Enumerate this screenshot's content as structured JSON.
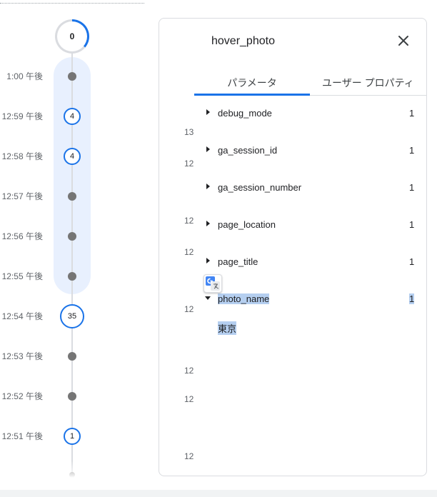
{
  "timeline": {
    "top_counter": "0",
    "rows": [
      {
        "time": "1:00 午後",
        "badge": ""
      },
      {
        "time": "12:59 午後",
        "badge": "4"
      },
      {
        "time": "12:58 午後",
        "badge": "4"
      },
      {
        "time": "12:57 午後",
        "badge": ""
      },
      {
        "time": "12:56 午後",
        "badge": ""
      },
      {
        "time": "12:55 午後",
        "badge": ""
      },
      {
        "time": "12:54 午後",
        "badge": "35"
      },
      {
        "time": "12:53 午後",
        "badge": ""
      },
      {
        "time": "12:52 午後",
        "badge": ""
      },
      {
        "time": "12:51 午後",
        "badge": "1"
      }
    ]
  },
  "panel": {
    "title": "hover_photo",
    "tabs": [
      {
        "label": "パラメータ",
        "active": true
      },
      {
        "label": "ユーザー プロパティ",
        "active": false
      }
    ],
    "side_numbers": [
      "13",
      "12",
      "12",
      "12",
      "12",
      "12",
      "12",
      "12"
    ],
    "params": [
      {
        "name": "debug_mode",
        "count": "1"
      },
      {
        "name": "ga_session_id",
        "count": "1"
      },
      {
        "name": "ga_session_number",
        "count": "1"
      },
      {
        "name": "page_location",
        "count": "1"
      },
      {
        "name": "page_title",
        "count": "1"
      },
      {
        "name": "photo_name",
        "count": "1",
        "expanded": true,
        "value": "東京"
      }
    ]
  },
  "colors": {
    "accent": "#1a73e8",
    "highlight": "#e8f0fe",
    "selection": "#b5cff0"
  },
  "icons": {
    "close": "close-icon",
    "translate": "google-translate-icon"
  }
}
